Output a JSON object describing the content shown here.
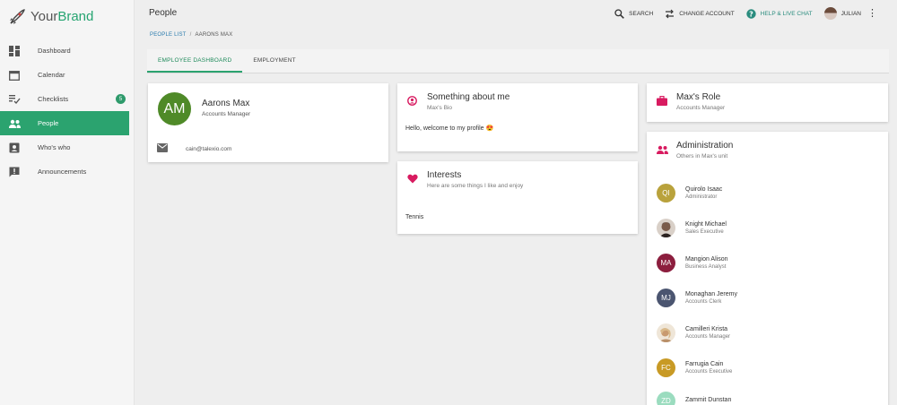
{
  "brand": {
    "name_part1": "Your",
    "name_part2": "Brand"
  },
  "sidebar": {
    "items": [
      {
        "label": "Dashboard"
      },
      {
        "label": "Calendar"
      },
      {
        "label": "Checklists",
        "badge": "5"
      },
      {
        "label": "People"
      },
      {
        "label": "Who's who"
      },
      {
        "label": "Announcements"
      }
    ]
  },
  "header": {
    "title": "People",
    "search": "SEARCH",
    "change_account": "CHANGE ACCOUNT",
    "help": "HELP & LIVE CHAT",
    "user": "JULIAN"
  },
  "breadcrumb": {
    "parent": "PEOPLE LIST",
    "sep": "/",
    "current": "AARONS MAX"
  },
  "tabs": [
    {
      "label": "EMPLOYEE DASHBOARD"
    },
    {
      "label": "EMPLOYMENT"
    }
  ],
  "profile": {
    "initials": "AM",
    "name": "Aarons Max",
    "role": "Accounts Manager",
    "email": "cain@talexio.com"
  },
  "about": {
    "title": "Something about me",
    "subtitle": "Max's Bio",
    "body": "Hello, welcome to my profile 😍"
  },
  "interests": {
    "title": "Interests",
    "subtitle": "Here are some things I like and enjoy",
    "body": "Tennis"
  },
  "role_card": {
    "title": "Max's Role",
    "subtitle": "Accounts Manager"
  },
  "admin": {
    "title": "Administration",
    "subtitle": "Others in Max's unit",
    "members": [
      {
        "initials": "QI",
        "name": "Quirolo Isaac",
        "role": "Administrator",
        "color": "#b9a23c"
      },
      {
        "initials": "",
        "name": "Knight Michael",
        "role": "Sales Executive",
        "color": "#3a2a24"
      },
      {
        "initials": "MA",
        "name": "Mangion Alison",
        "role": "Business Analyst",
        "color": "#8c1e3e"
      },
      {
        "initials": "MJ",
        "name": "Monaghan Jeremy",
        "role": "Accounts Clerk",
        "color": "#4b5570"
      },
      {
        "initials": "",
        "name": "Camilleri Krista",
        "role": "Accounts Manager",
        "color": "#d8b58f"
      },
      {
        "initials": "FC",
        "name": "Farrugia Cain",
        "role": "Accounts Executive",
        "color": "#c89a25"
      },
      {
        "initials": "ZD",
        "name": "Zammit Dunstan",
        "role": "",
        "color": "#9bdcbf"
      }
    ]
  },
  "colors": {
    "accent": "#2ba36f",
    "help": "#2a8c7e",
    "pink": "#d81b60"
  }
}
